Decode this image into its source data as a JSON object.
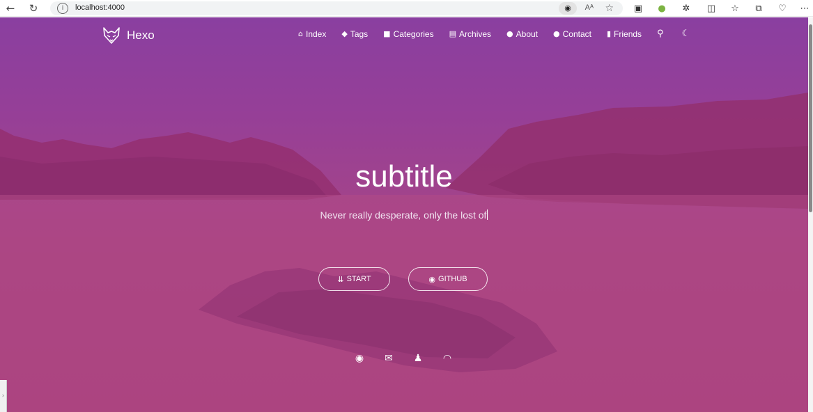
{
  "browser": {
    "url": "localhost:4000",
    "reader_icon": "eye-icon",
    "read_aloud_label": "Aᴬ"
  },
  "site": {
    "brand": "Hexo",
    "nav": [
      {
        "label": "Index",
        "icon": "home-icon"
      },
      {
        "label": "Tags",
        "icon": "tag-icon"
      },
      {
        "label": "Categories",
        "icon": "bookmark-icon"
      },
      {
        "label": "Archives",
        "icon": "archive-icon"
      },
      {
        "label": "About",
        "icon": "user-circle-icon"
      },
      {
        "label": "Contact",
        "icon": "comments-icon"
      },
      {
        "label": "Friends",
        "icon": "address-book-icon"
      }
    ],
    "search_icon": "search-icon",
    "theme_icon": "moon-icon"
  },
  "hero": {
    "title": "subtitle",
    "description": "Never really desperate, only the lost of",
    "start_label": "START",
    "github_label": "GITHUB",
    "social_icons": [
      "github-icon",
      "mail-icon",
      "qq-icon",
      "rss-icon"
    ],
    "overlay_color": "#a1438c"
  }
}
